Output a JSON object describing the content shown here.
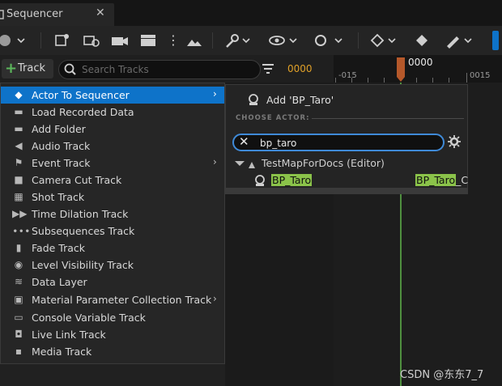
{
  "tab": {
    "title": "Sequencer",
    "close": "✕"
  },
  "track_row": {
    "add_track_label": "Track",
    "search_placeholder": "Search Tracks",
    "timecode": "0000"
  },
  "timeline": {
    "playhead_label": "0000",
    "left_tick": "-015",
    "right_tick": "0015"
  },
  "add_track_menu": {
    "items": [
      {
        "label": "Actor To Sequencer",
        "icon": "actor-icon",
        "has_submenu": true,
        "selected": true
      },
      {
        "label": "Load Recorded Data",
        "icon": "folder-open-icon",
        "has_submenu": false
      },
      {
        "label": "Add Folder",
        "icon": "folder-icon",
        "has_submenu": false
      },
      {
        "label": "Audio Track",
        "icon": "speaker-icon",
        "has_submenu": false
      },
      {
        "label": "Event Track",
        "icon": "flag-icon",
        "has_submenu": true
      },
      {
        "label": "Camera Cut Track",
        "icon": "camera-icon",
        "has_submenu": false
      },
      {
        "label": "Shot Track",
        "icon": "shot-grid-icon",
        "has_submenu": false
      },
      {
        "label": "Time Dilation Track",
        "icon": "fast-forward-icon",
        "has_submenu": false
      },
      {
        "label": "Subsequences Track",
        "icon": "dots-icon",
        "has_submenu": false
      },
      {
        "label": "Fade Track",
        "icon": "fade-icon",
        "has_submenu": false
      },
      {
        "label": "Level Visibility Track",
        "icon": "eye-icon",
        "has_submenu": false
      },
      {
        "label": "Data Layer",
        "icon": "layers-icon",
        "has_submenu": false
      },
      {
        "label": "Material Parameter Collection Track",
        "icon": "material-icon",
        "has_submenu": true
      },
      {
        "label": "Console Variable Track",
        "icon": "console-icon",
        "has_submenu": false
      },
      {
        "label": "Live Link Track",
        "icon": "live-link-icon",
        "has_submenu": false
      },
      {
        "label": "Media Track",
        "icon": "media-icon",
        "has_submenu": false
      }
    ]
  },
  "actor_submenu": {
    "add_label": "Add 'BP_Taro'",
    "section_header": "CHOOSE ACTOR:",
    "search_value": "bp_taro",
    "tree_root": "TestMapForDocs (Editor)",
    "result_name_highlight": "BP_Taro",
    "result_type_highlight": "BP_Taro",
    "result_type_suffix": "_C"
  },
  "watermark": "CSDN @东东7_7",
  "colors": {
    "accent": "#0e73c9",
    "search_focus": "#3f8ad8",
    "timecode": "#e0a028",
    "match_highlight": "#8bc34a",
    "playhead": "#b5582a",
    "add_plus": "#5cb85c"
  }
}
